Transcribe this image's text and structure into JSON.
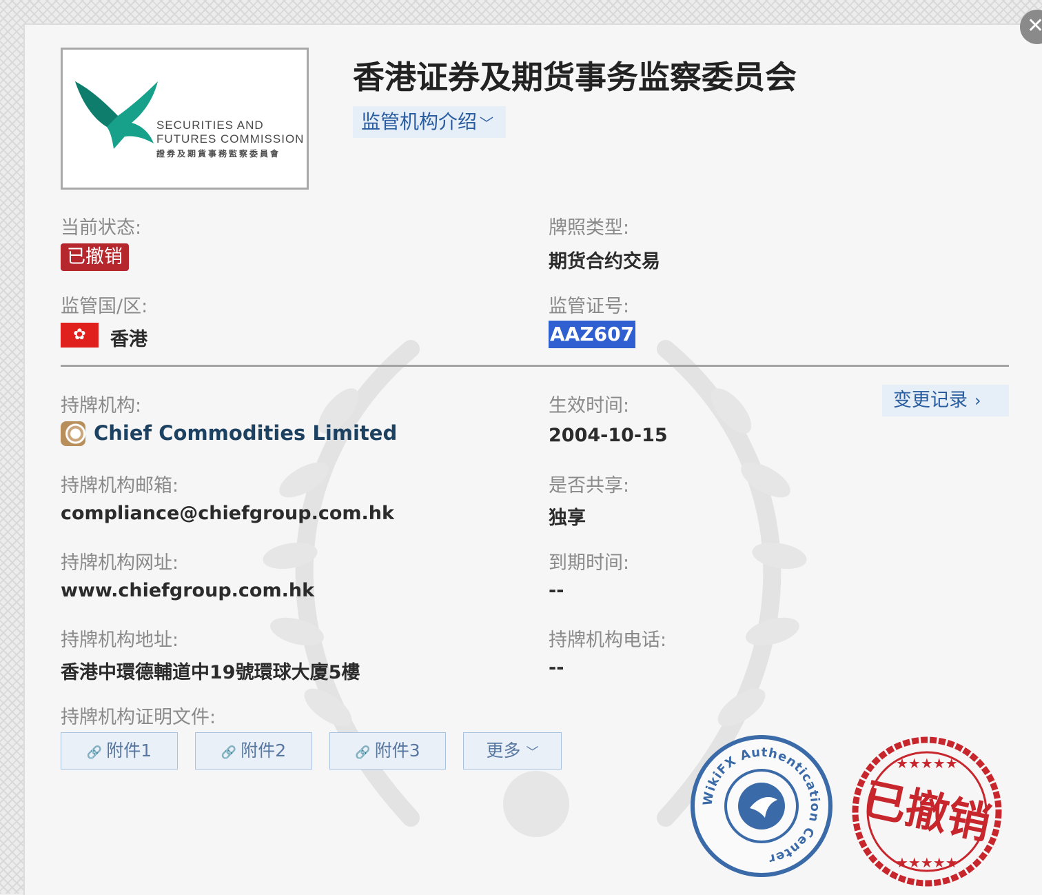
{
  "regulator": {
    "title": "香港证券及期货事务监察委员会",
    "intro_button": "监管机构介绍",
    "logo_en_line1": "SECURITIES AND",
    "logo_en_line2": "FUTURES COMMISSION",
    "logo_zh": "證券及期貨事務監察委員會"
  },
  "status": {
    "label": "当前状态:",
    "value": "已撤销",
    "color": "#b5272d"
  },
  "license_type": {
    "label": "牌照类型:",
    "value": "期货合约交易"
  },
  "region": {
    "label": "监管国/区:",
    "value": "香港",
    "flag_icon": "hong-kong-flag-icon"
  },
  "license_no": {
    "label": "监管证号:",
    "value": "AAZ607"
  },
  "holder": {
    "label": "持牌机构:",
    "value": "Chief Commodities Limited"
  },
  "effective": {
    "label": "生效时间:",
    "value": "2004-10-15"
  },
  "change_record": {
    "label": "变更记录"
  },
  "email": {
    "label": "持牌机构邮箱:",
    "value": "compliance@chiefgroup.com.hk"
  },
  "shared": {
    "label": "是否共享:",
    "value": "独享"
  },
  "website": {
    "label": "持牌机构网址:",
    "value": "www.chiefgroup.com.hk"
  },
  "expiry": {
    "label": "到期时间:",
    "value": "--"
  },
  "address": {
    "label": "持牌机构地址:",
    "value": "香港中環德輔道中19號環球大廈5樓"
  },
  "phone": {
    "label": "持牌机构电话:",
    "value": "--"
  },
  "documents": {
    "label": "持牌机构证明文件:",
    "attachments": [
      "附件1",
      "附件2",
      "附件3"
    ],
    "more": "更多"
  },
  "stamps": {
    "auth_text": "WikiFX Authentication Center",
    "revoked_text": "已撤销"
  },
  "colors": {
    "accent_blue": "#2a5d9f",
    "revoked_red": "#c8262d",
    "stamp_blue": "#3b6aa8"
  }
}
